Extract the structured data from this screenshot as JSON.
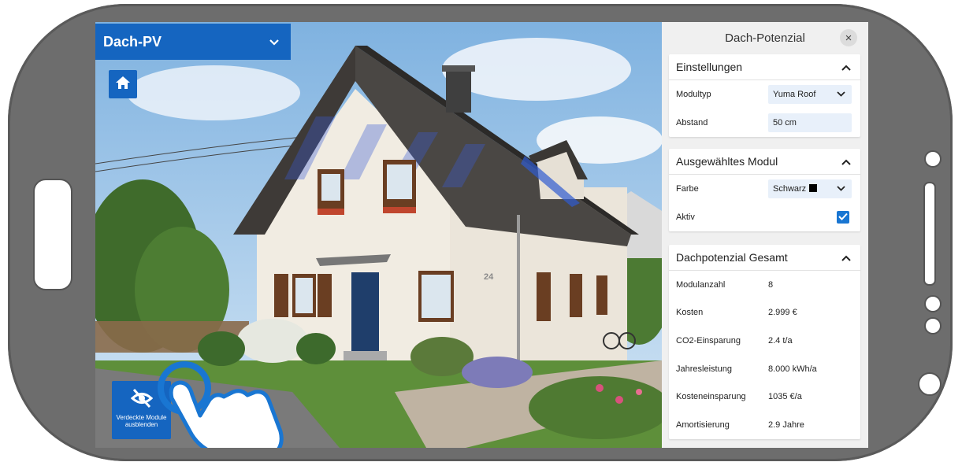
{
  "app": {
    "layer_select": "Dach-PV",
    "hide_button_label": "Verdeckte Module ausblenden"
  },
  "scene": {
    "house_number": "24"
  },
  "panel": {
    "title": "Dach-Potenzial",
    "settings": {
      "title": "Einstellungen",
      "module_type_label": "Modultyp",
      "module_type_value": "Yuma Roof",
      "spacing_label": "Abstand",
      "spacing_value": "50 cm"
    },
    "selected_module": {
      "title": "Ausgewähltes Modul",
      "color_label": "Farbe",
      "color_value": "Schwarz",
      "color_hex": "#000000",
      "active_label": "Aktiv",
      "active_checked": true
    },
    "summary": {
      "title": "Dachpotenzial Gesamt",
      "rows": [
        {
          "label": "Modulanzahl",
          "value": "8"
        },
        {
          "label": "Kosten",
          "value": "2.999 €"
        },
        {
          "label": "CO2-Einsparung",
          "value": "2.4 t/a"
        },
        {
          "label": "Jahresleistung",
          "value": "8.000 kWh/a"
        },
        {
          "label": "Kosteneinsparung",
          "value": "1035 €/a"
        },
        {
          "label": "Amortisierung",
          "value": "2.9 Jahre"
        }
      ]
    }
  },
  "colors": {
    "accent": "#1565c0",
    "checkbox": "#1976d2",
    "phone_frame": "#6d6d6d"
  }
}
